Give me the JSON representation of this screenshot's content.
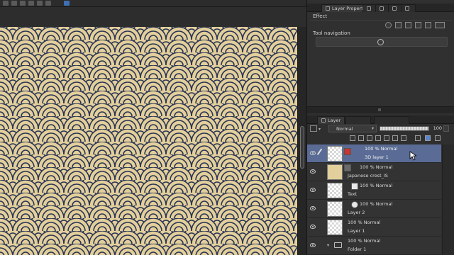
{
  "layer_property_panel": {
    "tab_label": "Layer Property",
    "effect_label": "Effect",
    "tool_navigation_label": "Tool navigation"
  },
  "layer_panel": {
    "tab_label": "Layer",
    "blend_mode": "Normal",
    "opacity": "100",
    "layers": [
      {
        "meta": "100 % Normal",
        "name": "3D layer 1",
        "selected": true,
        "icon": "3d-layer-icon"
      },
      {
        "meta": "100 % Normal",
        "name": "Japanese crest_IS",
        "selected": false,
        "icon": "image-material-icon"
      },
      {
        "meta": "100 % Normal",
        "name": "Text",
        "selected": false,
        "icon": "text-layer-icon"
      },
      {
        "meta": "100 % Normal",
        "name": "Layer 2",
        "selected": false,
        "icon": "raster-layer-icon"
      },
      {
        "meta": "100 % Normal",
        "name": "Layer 1",
        "selected": false,
        "icon": ""
      },
      {
        "meta": "100 % Normal",
        "name": "Folder 1",
        "selected": false,
        "icon": "folder-icon"
      }
    ]
  },
  "colors": {
    "pattern_fill": "#e3cf9b",
    "pattern_stroke": "#2a3555",
    "selected_row": "#5a6c95"
  }
}
